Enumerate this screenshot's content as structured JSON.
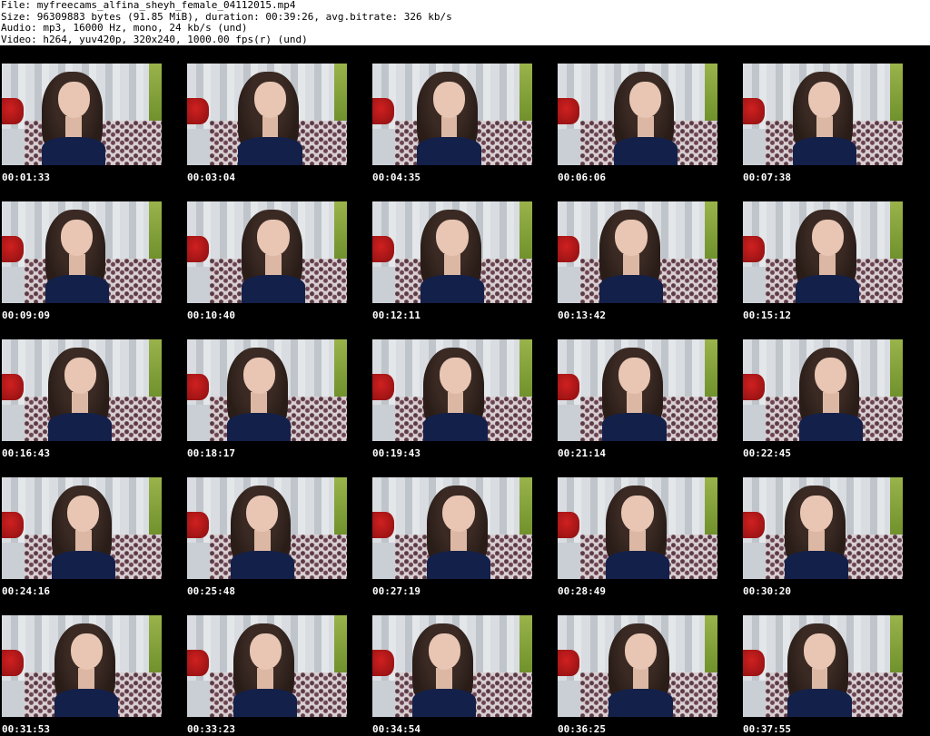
{
  "header": {
    "file": "File: myfreecams_alfina_sheyh_female_04112015.mp4",
    "size": "Size: 96309883 bytes (91.85 MiB), duration: 00:39:26, avg.bitrate: 326 kb/s",
    "audio": "Audio: mp3, 16000 Hz, mono, 24 kb/s (und)",
    "video": "Video: h264, yuv420p, 320x240, 1000.00 fps(r) (und)"
  },
  "thumbnails": [
    "00:01:33",
    "00:03:04",
    "00:04:35",
    "00:06:06",
    "00:07:38",
    "00:09:09",
    "00:10:40",
    "00:12:11",
    "00:13:42",
    "00:15:12",
    "00:16:43",
    "00:18:17",
    "00:19:43",
    "00:21:14",
    "00:22:45",
    "00:24:16",
    "00:25:48",
    "00:27:19",
    "00:28:49",
    "00:30:20",
    "00:31:53",
    "00:33:23",
    "00:34:54",
    "00:36:25",
    "00:37:55"
  ]
}
